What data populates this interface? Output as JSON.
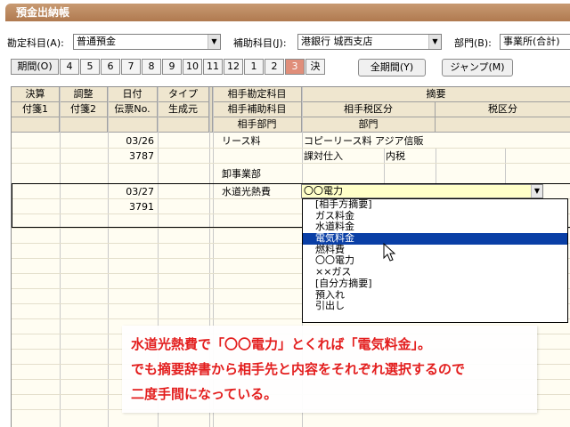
{
  "window": {
    "title": "預金出納帳"
  },
  "filters": {
    "account": {
      "label": "勘定科目(A):",
      "value": "普通預金"
    },
    "sub_account": {
      "label": "補助科目(J):",
      "value": "港銀行 城西支店"
    },
    "department": {
      "label": "部門(B):",
      "value": "事業所(合計)"
    }
  },
  "period_bar": {
    "first_label": "期間(O)",
    "months": [
      "4",
      "5",
      "6",
      "7",
      "8",
      "9",
      "10",
      "11",
      "12",
      "1",
      "2",
      "3",
      "決"
    ],
    "selected": "3",
    "full_period_label": "全期間(Y)",
    "jump_label": "ジャンプ(M)"
  },
  "grid": {
    "headers_row1": [
      "決算",
      "調整",
      "日付",
      "タイプ",
      "相手勘定科目",
      "摘要"
    ],
    "headers_row2": [
      "付箋1",
      "付箋2",
      "伝票No.",
      "生成元",
      "相手補助科目",
      "相手税区分",
      "税区分"
    ],
    "headers_row3": [
      "相手部門",
      "部門"
    ],
    "entries": [
      {
        "date": "03/26",
        "voucher": "3787",
        "account": "リース料",
        "summary": "コピーリース料 アジア信販",
        "partner_tax": "課対仕入",
        "tax": "内税",
        "partner_dept": "卸事業部"
      },
      {
        "date": "03/27",
        "voucher": "3791",
        "account": "水道光熱費",
        "summary": "〇〇電力"
      }
    ]
  },
  "dropdown": {
    "items": [
      "[相手方摘要]",
      "ガス料金",
      "水道料金",
      "電気料金",
      "燃料費",
      "〇〇電力",
      "××ガス",
      "[自分方摘要]",
      "預入れ",
      "引出し"
    ],
    "highlighted": "電気料金"
  },
  "callout": {
    "lines": [
      "水道光熱費で「〇〇電力」とくれば「電気料金」。",
      "でも摘要辞書から相手先と内容をそれぞれ選択するので",
      "二度手間になっている。"
    ]
  },
  "colors": {
    "title_bg": "#b07a50",
    "selected_period": "#e08e7a",
    "highlight": "#0a3fa6",
    "callout_text": "#e21313"
  }
}
